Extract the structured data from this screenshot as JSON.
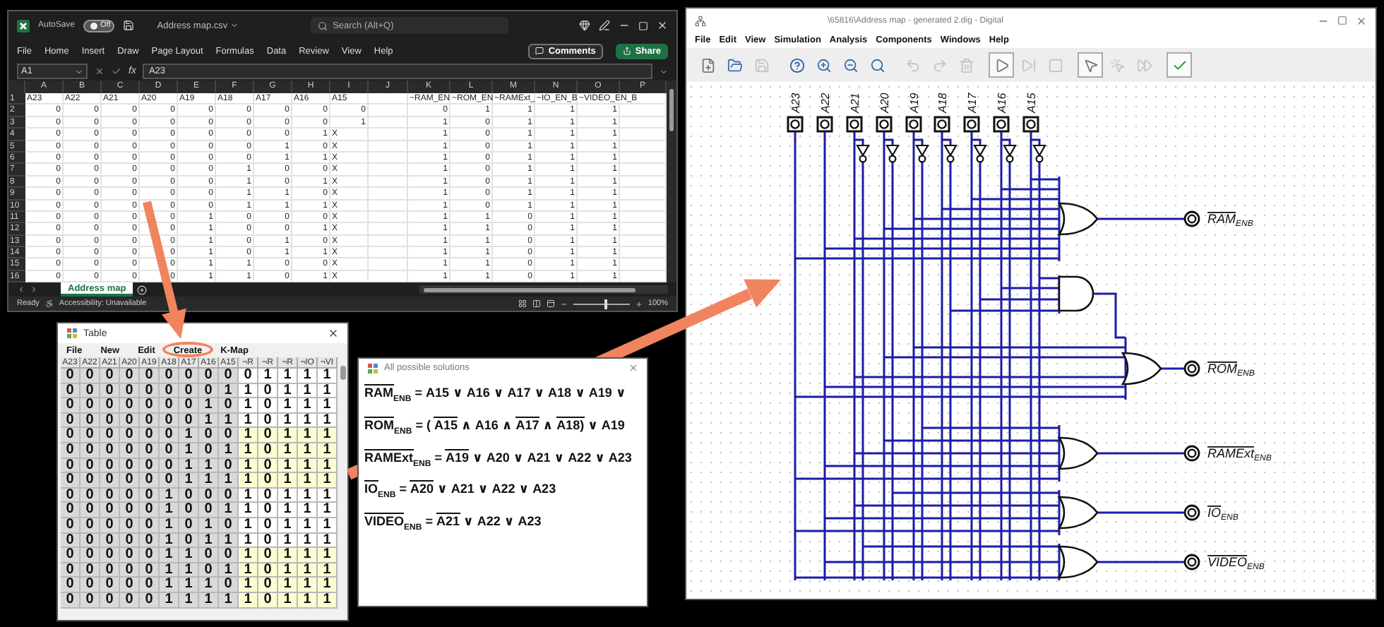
{
  "excel": {
    "autosave_label": "AutoSave",
    "autosave_on": false,
    "autosave_state": "Off",
    "file_name": "Address map.csv",
    "search_placeholder": "Search (Alt+Q)",
    "menu": [
      "File",
      "Home",
      "Insert",
      "Draw",
      "Page Layout",
      "Formulas",
      "Data",
      "Review",
      "View",
      "Help"
    ],
    "comments": "Comments",
    "share": "Share",
    "name_box": "A1",
    "fx_label": "fx",
    "formula": "A23",
    "columns": [
      "A",
      "B",
      "C",
      "D",
      "E",
      "F",
      "G",
      "H",
      "I",
      "J",
      "K",
      "L",
      "M",
      "N",
      "O",
      "P"
    ],
    "header_row": {
      "num": "1",
      "inputs": [
        "A23",
        "A22",
        "A21",
        "A20",
        "A19",
        "A18",
        "A17",
        "A16",
        "A15"
      ],
      "outputs": [
        "~RAM_EN",
        "~ROM_EN",
        "~RAMExt_",
        "~IO_EN_B",
        "~VIDEO_EN_B"
      ]
    },
    "rows": [
      {
        "num": "2",
        "bits": [
          "0",
          "0",
          "0",
          "0",
          "0",
          "0",
          "0",
          "0"
        ],
        "a15": {
          "kind": "number",
          "value": "0"
        },
        "outputs": [
          "0",
          "1",
          "1",
          "1",
          "1"
        ]
      },
      {
        "num": "3",
        "bits": [
          "0",
          "0",
          "0",
          "0",
          "0",
          "0",
          "0",
          "0"
        ],
        "a15": {
          "kind": "number",
          "value": "1"
        },
        "outputs": [
          "1",
          "0",
          "1",
          "1",
          "1"
        ]
      },
      {
        "num": "4",
        "bits": [
          "0",
          "0",
          "0",
          "0",
          "0",
          "0",
          "0",
          "1"
        ],
        "a15": {
          "kind": "text",
          "value": "X"
        },
        "outputs": [
          "1",
          "0",
          "1",
          "1",
          "1"
        ]
      },
      {
        "num": "5",
        "bits": [
          "0",
          "0",
          "0",
          "0",
          "0",
          "0",
          "1",
          "0"
        ],
        "a15": {
          "kind": "text",
          "value": "X"
        },
        "outputs": [
          "1",
          "0",
          "1",
          "1",
          "1"
        ]
      },
      {
        "num": "6",
        "bits": [
          "0",
          "0",
          "0",
          "0",
          "0",
          "0",
          "1",
          "1"
        ],
        "a15": {
          "kind": "text",
          "value": "X"
        },
        "outputs": [
          "1",
          "0",
          "1",
          "1",
          "1"
        ]
      },
      {
        "num": "7",
        "bits": [
          "0",
          "0",
          "0",
          "0",
          "0",
          "1",
          "0",
          "0"
        ],
        "a15": {
          "kind": "text",
          "value": "X"
        },
        "outputs": [
          "1",
          "0",
          "1",
          "1",
          "1"
        ]
      },
      {
        "num": "8",
        "bits": [
          "0",
          "0",
          "0",
          "0",
          "0",
          "1",
          "0",
          "1"
        ],
        "a15": {
          "kind": "text",
          "value": "X"
        },
        "outputs": [
          "1",
          "0",
          "1",
          "1",
          "1"
        ]
      },
      {
        "num": "9",
        "bits": [
          "0",
          "0",
          "0",
          "0",
          "0",
          "1",
          "1",
          "0"
        ],
        "a15": {
          "kind": "text",
          "value": "X"
        },
        "outputs": [
          "1",
          "0",
          "1",
          "1",
          "1"
        ]
      },
      {
        "num": "10",
        "bits": [
          "0",
          "0",
          "0",
          "0",
          "0",
          "1",
          "1",
          "1"
        ],
        "a15": {
          "kind": "text",
          "value": "X"
        },
        "outputs": [
          "1",
          "0",
          "1",
          "1",
          "1"
        ]
      },
      {
        "num": "11",
        "bits": [
          "0",
          "0",
          "0",
          "0",
          "1",
          "0",
          "0",
          "0"
        ],
        "a15": {
          "kind": "text",
          "value": "X"
        },
        "outputs": [
          "1",
          "1",
          "0",
          "1",
          "1"
        ]
      },
      {
        "num": "12",
        "bits": [
          "0",
          "0",
          "0",
          "0",
          "1",
          "0",
          "0",
          "1"
        ],
        "a15": {
          "kind": "text",
          "value": "X"
        },
        "outputs": [
          "1",
          "1",
          "0",
          "1",
          "1"
        ]
      },
      {
        "num": "13",
        "bits": [
          "0",
          "0",
          "0",
          "0",
          "1",
          "0",
          "1",
          "0"
        ],
        "a15": {
          "kind": "text",
          "value": "X"
        },
        "outputs": [
          "1",
          "1",
          "0",
          "1",
          "1"
        ]
      },
      {
        "num": "14",
        "bits": [
          "0",
          "0",
          "0",
          "0",
          "1",
          "0",
          "1",
          "1"
        ],
        "a15": {
          "kind": "text",
          "value": "X"
        },
        "outputs": [
          "1",
          "1",
          "0",
          "1",
          "1"
        ]
      },
      {
        "num": "15",
        "bits": [
          "0",
          "0",
          "0",
          "0",
          "1",
          "1",
          "0",
          "0"
        ],
        "a15": {
          "kind": "text",
          "value": "X"
        },
        "outputs": [
          "1",
          "1",
          "0",
          "1",
          "1"
        ]
      },
      {
        "num": "16",
        "bits": [
          "0",
          "0",
          "0",
          "0",
          "1",
          "1",
          "0",
          "1"
        ],
        "a15": {
          "kind": "text",
          "value": "X"
        },
        "outputs": [
          "1",
          "1",
          "0",
          "1",
          "1"
        ]
      }
    ],
    "sheet_tabs": [
      {
        "label": "Address map",
        "selected": true
      }
    ],
    "status": "Ready",
    "accessibility": "Accessibility: Unavailable",
    "zoom_slider": {
      "level": 0.55
    },
    "zoom": "100%"
  },
  "table_window": {
    "title": "Table",
    "menu": [
      "File",
      "New",
      "Edit",
      "Create",
      "K-Map"
    ],
    "columns": [
      "A23",
      "A22",
      "A21",
      "A20",
      "A19",
      "A18",
      "A17",
      "A16",
      "A15",
      "¬R",
      "¬R",
      "¬R",
      "¬IO",
      "¬VI"
    ],
    "rows": [
      {
        "inputs": [
          "0",
          "0",
          "0",
          "0",
          "0",
          "0",
          "0",
          "0",
          "0"
        ],
        "outputs": [
          "0",
          "1",
          "1",
          "1",
          "1"
        ],
        "highlighted": false
      },
      {
        "inputs": [
          "0",
          "0",
          "0",
          "0",
          "0",
          "0",
          "0",
          "0",
          "1"
        ],
        "outputs": [
          "1",
          "0",
          "1",
          "1",
          "1"
        ],
        "highlighted": false
      },
      {
        "inputs": [
          "0",
          "0",
          "0",
          "0",
          "0",
          "0",
          "0",
          "1",
          "0"
        ],
        "outputs": [
          "1",
          "0",
          "1",
          "1",
          "1"
        ],
        "highlighted": false
      },
      {
        "inputs": [
          "0",
          "0",
          "0",
          "0",
          "0",
          "0",
          "0",
          "1",
          "1"
        ],
        "outputs": [
          "1",
          "0",
          "1",
          "1",
          "1"
        ],
        "highlighted": false
      },
      {
        "inputs": [
          "0",
          "0",
          "0",
          "0",
          "0",
          "0",
          "1",
          "0",
          "0"
        ],
        "outputs": [
          "1",
          "0",
          "1",
          "1",
          "1"
        ],
        "highlighted": true
      },
      {
        "inputs": [
          "0",
          "0",
          "0",
          "0",
          "0",
          "0",
          "1",
          "0",
          "1"
        ],
        "outputs": [
          "1",
          "0",
          "1",
          "1",
          "1"
        ],
        "highlighted": true
      },
      {
        "inputs": [
          "0",
          "0",
          "0",
          "0",
          "0",
          "0",
          "1",
          "1",
          "0"
        ],
        "outputs": [
          "1",
          "0",
          "1",
          "1",
          "1"
        ],
        "highlighted": true
      },
      {
        "inputs": [
          "0",
          "0",
          "0",
          "0",
          "0",
          "0",
          "1",
          "1",
          "1"
        ],
        "outputs": [
          "1",
          "0",
          "1",
          "1",
          "1"
        ],
        "highlighted": true
      },
      {
        "inputs": [
          "0",
          "0",
          "0",
          "0",
          "0",
          "1",
          "0",
          "0",
          "0"
        ],
        "outputs": [
          "1",
          "0",
          "1",
          "1",
          "1"
        ],
        "highlighted": false
      },
      {
        "inputs": [
          "0",
          "0",
          "0",
          "0",
          "0",
          "1",
          "0",
          "0",
          "1"
        ],
        "outputs": [
          "1",
          "0",
          "1",
          "1",
          "1"
        ],
        "highlighted": false
      },
      {
        "inputs": [
          "0",
          "0",
          "0",
          "0",
          "0",
          "1",
          "0",
          "1",
          "0"
        ],
        "outputs": [
          "1",
          "0",
          "1",
          "1",
          "1"
        ],
        "highlighted": false
      },
      {
        "inputs": [
          "0",
          "0",
          "0",
          "0",
          "0",
          "1",
          "0",
          "1",
          "1"
        ],
        "outputs": [
          "1",
          "0",
          "1",
          "1",
          "1"
        ],
        "highlighted": false
      },
      {
        "inputs": [
          "0",
          "0",
          "0",
          "0",
          "0",
          "1",
          "1",
          "0",
          "0"
        ],
        "outputs": [
          "1",
          "0",
          "1",
          "1",
          "1"
        ],
        "highlighted": true
      },
      {
        "inputs": [
          "0",
          "0",
          "0",
          "0",
          "0",
          "1",
          "1",
          "0",
          "1"
        ],
        "outputs": [
          "1",
          "0",
          "1",
          "1",
          "1"
        ],
        "highlighted": true
      },
      {
        "inputs": [
          "0",
          "0",
          "0",
          "0",
          "0",
          "1",
          "1",
          "1",
          "0"
        ],
        "outputs": [
          "1",
          "0",
          "1",
          "1",
          "1"
        ],
        "highlighted": true
      },
      {
        "inputs": [
          "0",
          "0",
          "0",
          "0",
          "0",
          "1",
          "1",
          "1",
          "1"
        ],
        "outputs": [
          "1",
          "0",
          "1",
          "1",
          "1"
        ],
        "highlighted": true
      }
    ]
  },
  "solutions_window": {
    "title": "All possible solutions",
    "equations": [
      {
        "lhs": "RAM",
        "sub": "ENB",
        "negated": true,
        "terms": [
          {
            "text": "=",
            "negated": false
          },
          {
            "text": "A15",
            "negated": false
          },
          {
            "text": "∨",
            "negated": false
          },
          {
            "text": "A16",
            "negated": false
          },
          {
            "text": "∨",
            "negated": false
          },
          {
            "text": "A17",
            "negated": false
          },
          {
            "text": "∨",
            "negated": false
          },
          {
            "text": "A18",
            "negated": false
          },
          {
            "text": "∨",
            "negated": false
          },
          {
            "text": "A19",
            "negated": false
          },
          {
            "text": "∨",
            "negated": false
          }
        ]
      },
      {
        "lhs": "ROM",
        "sub": "ENB",
        "negated": true,
        "terms": [
          {
            "text": "=",
            "negated": false
          },
          {
            "text": "(",
            "negated": false
          },
          {
            "text": "A15",
            "negated": true
          },
          {
            "text": "∧",
            "negated": false
          },
          {
            "text": "A16",
            "negated": false
          },
          {
            "text": "∧",
            "negated": false
          },
          {
            "text": "A17",
            "negated": true
          },
          {
            "text": "∧",
            "negated": false
          },
          {
            "text": "A18)",
            "negated": true
          },
          {
            "text": "∨",
            "negated": false
          },
          {
            "text": "A19",
            "negated": false
          }
        ]
      },
      {
        "lhs": "RAMExt",
        "sub": "ENB",
        "negated": true,
        "terms": [
          {
            "text": "=",
            "negated": false
          },
          {
            "text": "A19",
            "negated": true
          },
          {
            "text": "∨",
            "negated": false
          },
          {
            "text": "A20",
            "negated": false
          },
          {
            "text": "∨",
            "negated": false
          },
          {
            "text": "A21",
            "negated": false
          },
          {
            "text": "∨",
            "negated": false
          },
          {
            "text": "A22",
            "negated": false
          },
          {
            "text": "∨",
            "negated": false
          },
          {
            "text": "A23",
            "negated": false
          }
        ]
      },
      {
        "lhs": "IO",
        "sub": "ENB",
        "negated": true,
        "terms": [
          {
            "text": "=",
            "negated": false
          },
          {
            "text": "A20",
            "negated": true
          },
          {
            "text": "∨",
            "negated": false
          },
          {
            "text": "A21",
            "negated": false
          },
          {
            "text": "∨",
            "negated": false
          },
          {
            "text": "A22",
            "negated": false
          },
          {
            "text": "∨",
            "negated": false
          },
          {
            "text": "A23",
            "negated": false
          }
        ]
      },
      {
        "lhs": "VIDEO",
        "sub": "ENB",
        "negated": true,
        "terms": [
          {
            "text": "=",
            "negated": false
          },
          {
            "text": "A21",
            "negated": true
          },
          {
            "text": "∨",
            "negated": false
          },
          {
            "text": "A22",
            "negated": false
          },
          {
            "text": "∨",
            "negated": false
          },
          {
            "text": "A23",
            "negated": false
          }
        ]
      }
    ]
  },
  "digital_window": {
    "title": "\\65816\\Address map - generated 2.dig - Digital",
    "menu": [
      "File",
      "Edit",
      "View",
      "Simulation",
      "Analysis",
      "Components",
      "Windows",
      "Help"
    ],
    "toolbar": [
      {
        "kind": "new",
        "disabled": false,
        "raised": false
      },
      {
        "kind": "open",
        "disabled": false,
        "raised": false
      },
      {
        "kind": "save",
        "disabled": true,
        "raised": false
      },
      {
        "kind": "help",
        "disabled": false,
        "raised": false
      },
      {
        "kind": "zoom-in",
        "disabled": false,
        "raised": false
      },
      {
        "kind": "zoom-out",
        "disabled": false,
        "raised": false
      },
      {
        "kind": "zoom-fit",
        "disabled": false,
        "raised": false
      },
      {
        "kind": "undo",
        "disabled": true,
        "raised": false
      },
      {
        "kind": "redo",
        "disabled": true,
        "raised": false
      },
      {
        "kind": "delete",
        "disabled": true,
        "raised": false
      },
      {
        "kind": "run",
        "disabled": false,
        "raised": true
      },
      {
        "kind": "step",
        "disabled": true,
        "raised": false
      },
      {
        "kind": "stop",
        "disabled": true,
        "raised": false
      },
      {
        "kind": "select",
        "disabled": false,
        "raised": true
      },
      {
        "kind": "select-step",
        "disabled": true,
        "raised": false
      },
      {
        "kind": "select-run",
        "disabled": true,
        "raised": false
      },
      {
        "kind": "check",
        "disabled": false,
        "raised": true
      }
    ],
    "inputs": [
      "A23",
      "A22",
      "A21",
      "A20",
      "A19",
      "A18",
      "A17",
      "A16",
      "A15"
    ],
    "outputs": [
      {
        "name": "RAM",
        "sub": "ENB"
      },
      {
        "name": "ROM",
        "sub": "ENB"
      },
      {
        "name": "RAMExt",
        "sub": "ENB"
      },
      {
        "name": "IO",
        "sub": "ENB"
      },
      {
        "name": "VIDEO",
        "sub": "ENB"
      }
    ]
  }
}
